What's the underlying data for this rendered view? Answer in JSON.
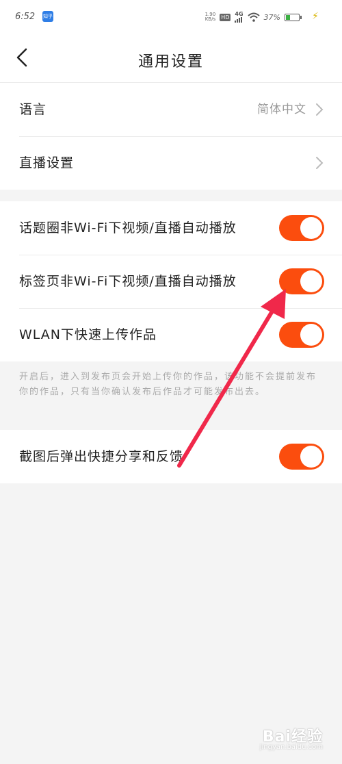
{
  "status_bar": {
    "time": "6:52",
    "app_badge": "知乎",
    "net_speed_value": "1.90",
    "net_speed_unit": "KB/s",
    "hd_label": "HD",
    "network_label": "4G",
    "battery_percent": "37%",
    "battery_level": 0.37
  },
  "header": {
    "title": "通用设置"
  },
  "settings": {
    "language": {
      "label": "语言",
      "value": "简体中文"
    },
    "live": {
      "label": "直播设置"
    },
    "topic_autoplay": {
      "label": "话题圈非Wi-Fi下视频/直播自动播放",
      "enabled": true
    },
    "tag_autoplay": {
      "label": "标签页非Wi-Fi下视频/直播自动播放",
      "enabled": true
    },
    "wlan_upload": {
      "label": "WLAN下快速上传作品",
      "enabled": true
    },
    "wlan_note": "开启后，进入到发布页会开始上传你的作品，该功能不会提前发布你的作品，只有当你确认发布后作品才可能发布出去。",
    "screenshot_share": {
      "label": "截图后弹出快捷分享和反馈",
      "enabled": true
    }
  },
  "watermark": {
    "brand": "Bai经验",
    "url": "jingyan.baidu.com"
  },
  "colors": {
    "toggle_on": "#fb4d0e",
    "annotation_arrow": "#f0284a"
  }
}
